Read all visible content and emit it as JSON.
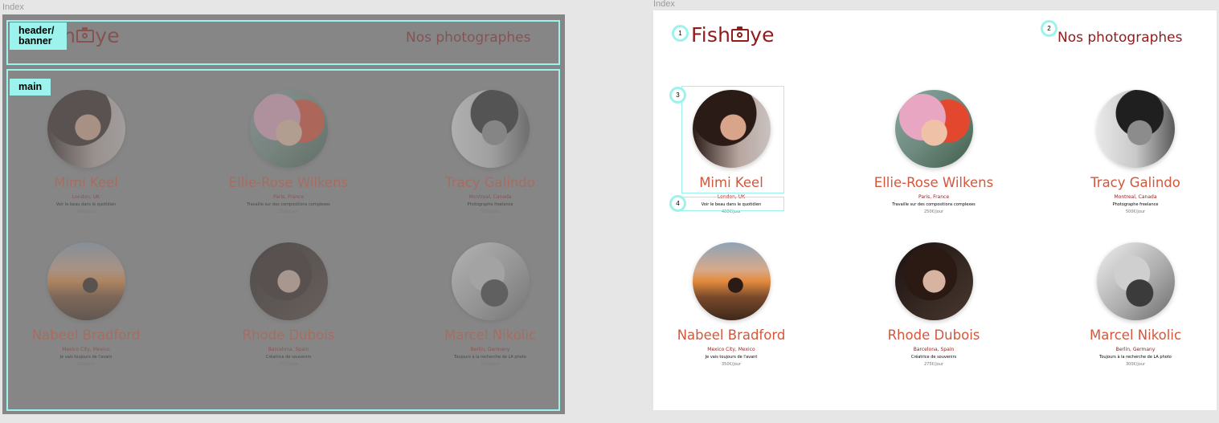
{
  "frames": {
    "left_label": "Index",
    "right_label": "Index"
  },
  "header": {
    "logo_left": "Fish",
    "logo_right": "ye",
    "logo_left_partial": "sh",
    "nav_title": "Nos photographes"
  },
  "annotations": {
    "header_tag": "header/\nbanner",
    "main_tag": "main",
    "markers": [
      "1",
      "2",
      "3",
      "4"
    ]
  },
  "photographers": [
    {
      "name": "Mimi Keel",
      "location": "London, UK",
      "tagline": "Voir le beau dans le quotidien",
      "price": "400€/jour",
      "portrait": "p-mimi"
    },
    {
      "name": "Ellie-Rose Wilkens",
      "location": "Paris, France",
      "tagline": "Travaille sur des compositions complexes",
      "price": "250€/jour",
      "portrait": "p-ellie"
    },
    {
      "name": "Tracy Galindo",
      "location": "Montreal, Canada",
      "tagline": "Photographe freelance",
      "price": "500€/jour",
      "portrait": "p-tracy"
    },
    {
      "name": "Nabeel Bradford",
      "location": "Mexico City, Mexico",
      "tagline": "Je vais toujours de l'avant",
      "price": "350€/jour",
      "portrait": "p-nabeel"
    },
    {
      "name": "Rhode Dubois",
      "location": "Barcelona, Spain",
      "tagline": "Créatrice de souvenirs",
      "price": "275€/jour",
      "portrait": "p-rhode"
    },
    {
      "name": "Marcel Nikolic",
      "location": "Berlin, Germany",
      "tagline": "Toujours à la recherche de LA photo",
      "price": "300€/jour",
      "portrait": "p-marcel"
    }
  ],
  "colors": {
    "brand": "#901c1c",
    "name_accent": "#d3573c",
    "annotation": "#9cf2ec"
  }
}
